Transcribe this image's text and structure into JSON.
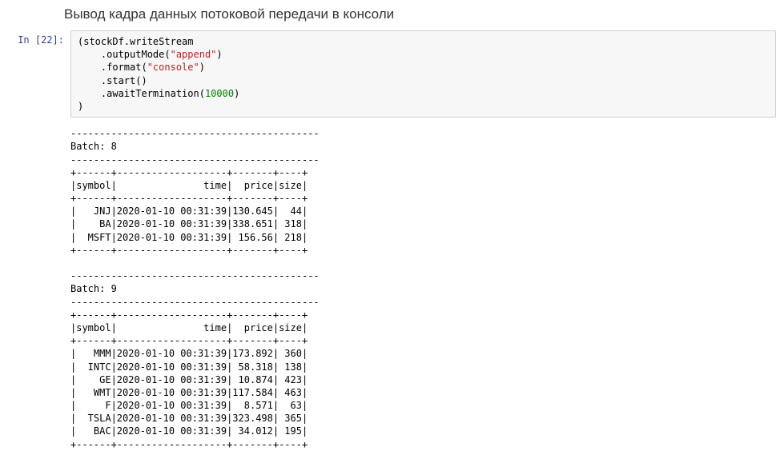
{
  "heading": "Вывод кадра данных потоковой передачи в консоли",
  "prompt": {
    "label": "In [",
    "count": "22",
    "suffix": "]:"
  },
  "code": {
    "lines": [
      {
        "segments": [
          {
            "t": "(stockDf.writeStream",
            "cls": "tok-p"
          }
        ]
      },
      {
        "segments": [
          {
            "t": "    .outputMode(",
            "cls": "tok-p"
          },
          {
            "t": "\"append\"",
            "cls": "tok-s"
          },
          {
            "t": ")",
            "cls": "tok-p"
          }
        ]
      },
      {
        "segments": [
          {
            "t": "    .format(",
            "cls": "tok-p"
          },
          {
            "t": "\"console\"",
            "cls": "tok-s"
          },
          {
            "t": ")",
            "cls": "tok-p"
          }
        ]
      },
      {
        "segments": [
          {
            "t": "    .start()",
            "cls": "tok-p"
          }
        ]
      },
      {
        "segments": [
          {
            "t": "    .awaitTermination(",
            "cls": "tok-p"
          },
          {
            "t": "10000",
            "cls": "tok-n"
          },
          {
            "t": ")",
            "cls": "tok-p"
          }
        ]
      },
      {
        "segments": [
          {
            "t": ")",
            "cls": "tok-p"
          }
        ]
      }
    ]
  },
  "output": {
    "batches": [
      {
        "divider": "-------------------------------------------",
        "header": "Batch: 8",
        "hdivider": "-------------------------------------------",
        "sep": "+------+-------------------+-------+----+",
        "colhead": "|symbol|               time|  price|size|",
        "rows": [
          "|   JNJ|2020-01-10 00:31:39|130.645|  44|",
          "|    BA|2020-01-10 00:31:39|338.651| 318|",
          "|  MSFT|2020-01-10 00:31:39| 156.56| 218|"
        ]
      },
      {
        "divider": "-------------------------------------------",
        "header": "Batch: 9",
        "hdivider": "-------------------------------------------",
        "sep": "+------+-------------------+-------+----+",
        "colhead": "|symbol|               time|  price|size|",
        "rows": [
          "|   MMM|2020-01-10 00:31:39|173.892| 360|",
          "|  INTC|2020-01-10 00:31:39| 58.318| 138|",
          "|    GE|2020-01-10 00:31:39| 10.874| 423|",
          "|   WMT|2020-01-10 00:31:39|117.584| 463|",
          "|     F|2020-01-10 00:31:39|  8.571|  63|",
          "|  TSLA|2020-01-10 00:31:39|323.498| 365|",
          "|   BAC|2020-01-10 00:31:39| 34.012| 195|"
        ]
      }
    ]
  }
}
